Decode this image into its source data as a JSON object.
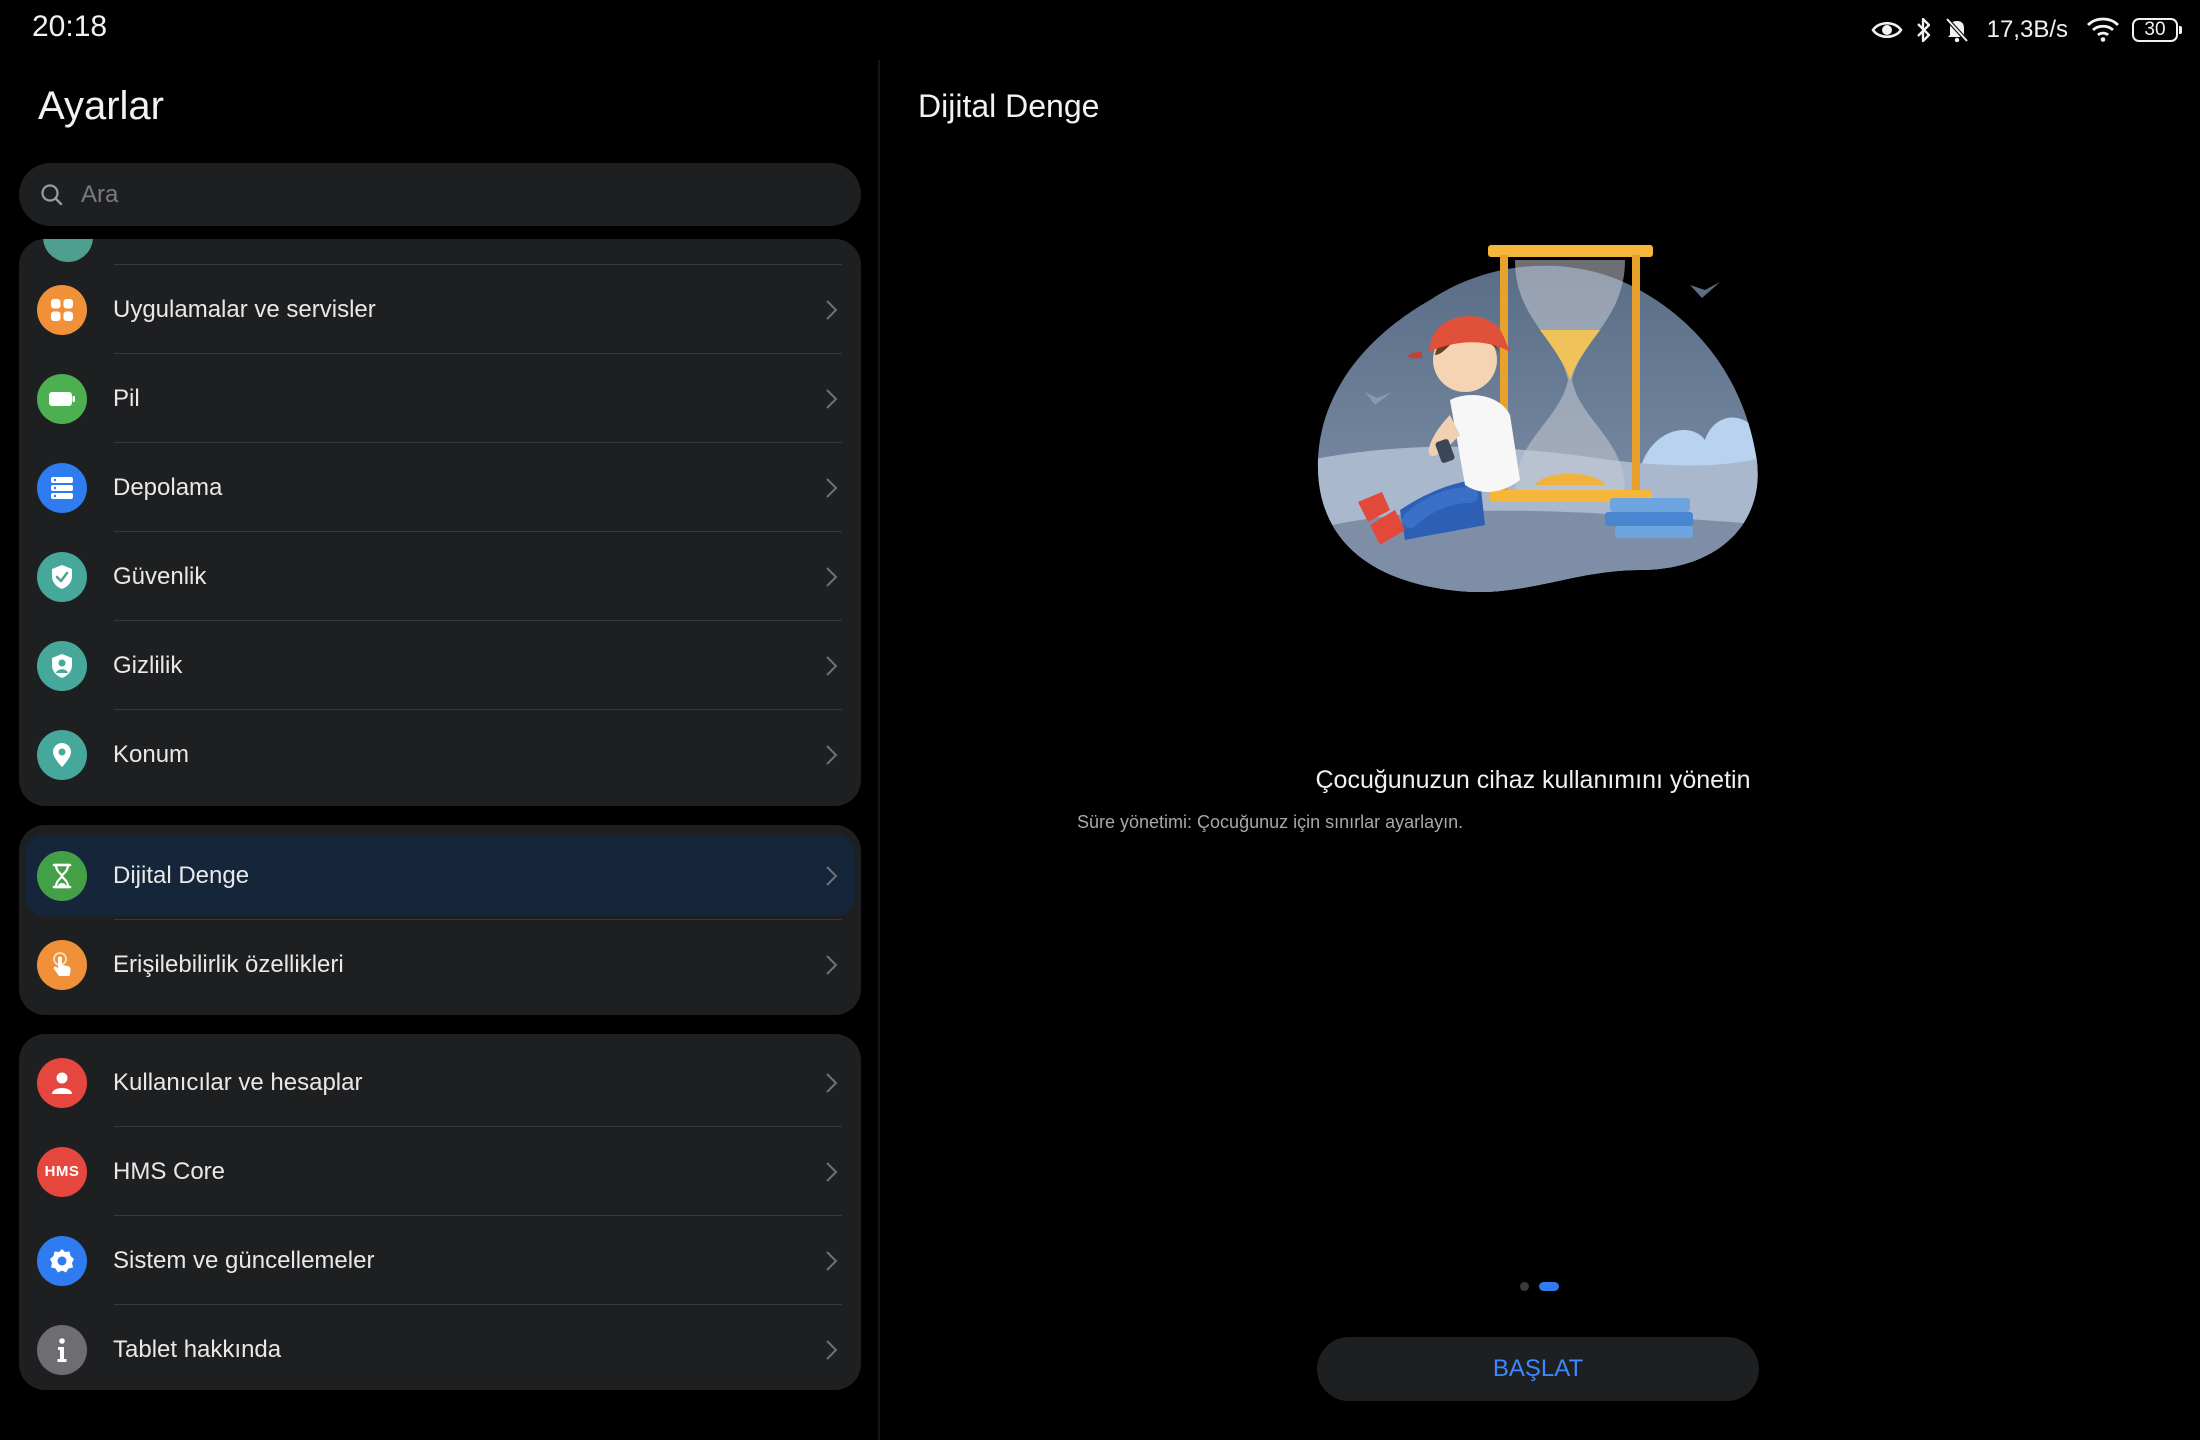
{
  "status_bar": {
    "time": "20:18",
    "net_speed": "17,3B/s",
    "battery_level": "30",
    "icons": [
      "eye-icon",
      "bluetooth-icon",
      "mute-icon",
      "wifi-icon",
      "battery-icon"
    ]
  },
  "settings": {
    "title": "Ayarlar",
    "search_placeholder": "Ara",
    "groups": [
      {
        "items": [
          {
            "label": "Uygulamalar ve servisler",
            "icon": "apps-grid-icon",
            "color": "#f0913a"
          },
          {
            "label": "Pil",
            "icon": "battery-icon",
            "color": "#4caf50"
          },
          {
            "label": "Depolama",
            "icon": "storage-icon",
            "color": "#2f7bf0"
          },
          {
            "label": "Güvenlik",
            "icon": "shield-check-icon",
            "color": "#46a89a"
          },
          {
            "label": "Gizlilik",
            "icon": "privacy-shield-icon",
            "color": "#46a89a"
          },
          {
            "label": "Konum",
            "icon": "location-pin-icon",
            "color": "#46a89a"
          }
        ]
      },
      {
        "items": [
          {
            "label": "Dijital Denge",
            "icon": "hourglass-icon",
            "color": "#43a047",
            "selected": true
          },
          {
            "label": "Erişilebilirlik özellikleri",
            "icon": "hand-pointer-icon",
            "color": "#f0913a"
          }
        ]
      },
      {
        "items": [
          {
            "label": "Kullanıcılar ve hesaplar",
            "icon": "user-icon",
            "color": "#e5463d"
          },
          {
            "label": "HMS Core",
            "icon": "hms-icon",
            "icon_text": "HMS",
            "color": "#e5463d"
          },
          {
            "label": "Sistem ve güncellemeler",
            "icon": "gear-icon",
            "color": "#2f7bf0"
          },
          {
            "label": "Tablet hakkında",
            "icon": "info-icon",
            "color": "#6e6e72"
          }
        ]
      }
    ]
  },
  "detail": {
    "title": "Dijital Denge",
    "illustration": "child-with-hourglass-illustration",
    "headline": "Çocuğunuzun cihaz kullanımını yönetin",
    "subtext": "Süre yönetimi: Çocuğunuz için sınırlar ayarlayın.",
    "pager": {
      "total": 2,
      "active": 2
    },
    "start_button": "BAŞLAT"
  },
  "colors": {
    "background": "#000000",
    "card": "#1e1f21",
    "accent": "#3b88ff",
    "selected_row": "#16263a"
  }
}
